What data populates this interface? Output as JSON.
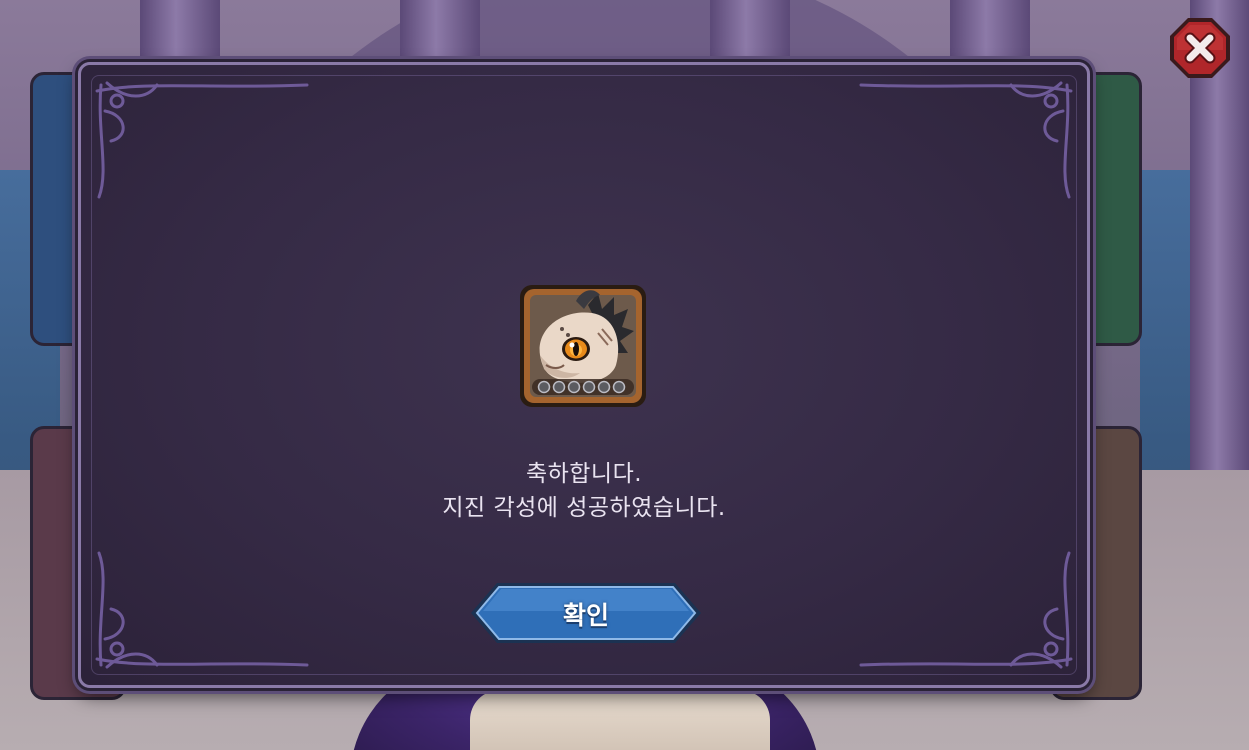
{
  "dialog": {
    "message_line1": "축하합니다.",
    "message_line2": "지진 각성에 성공하였습니다.",
    "confirm_label": "확인"
  },
  "reward": {
    "icon": "dragon-hatchling-portrait-icon",
    "awakening_slots_total": 6
  },
  "close_icon": "close-x-icon",
  "colors": {
    "dialog_bg": "#352a45",
    "dialog_border": "#8a7aa8",
    "confirm_button": "#2f6fb8",
    "close_button": "#b0262a",
    "text": "#e9e3f0"
  }
}
